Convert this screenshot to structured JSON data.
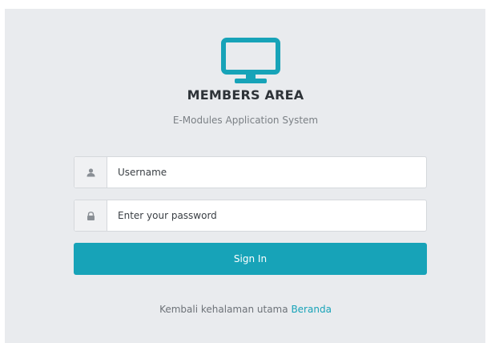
{
  "brand": {
    "icon": "monitor-icon",
    "title": "MEMBERS AREA",
    "subtitle": "E-Modules Application System"
  },
  "form": {
    "username": {
      "icon": "user-icon",
      "placeholder": "Username",
      "value": ""
    },
    "password": {
      "icon": "lock-icon",
      "placeholder": "Enter your password",
      "value": ""
    },
    "submit_label": "Sign In"
  },
  "footer": {
    "text": "Kembali kehalaman utama",
    "link_label": "Beranda"
  },
  "colors": {
    "accent": "#17a3b8",
    "panel_bg": "#e9ebee",
    "title": "#2e3338",
    "muted": "#7b8085"
  }
}
